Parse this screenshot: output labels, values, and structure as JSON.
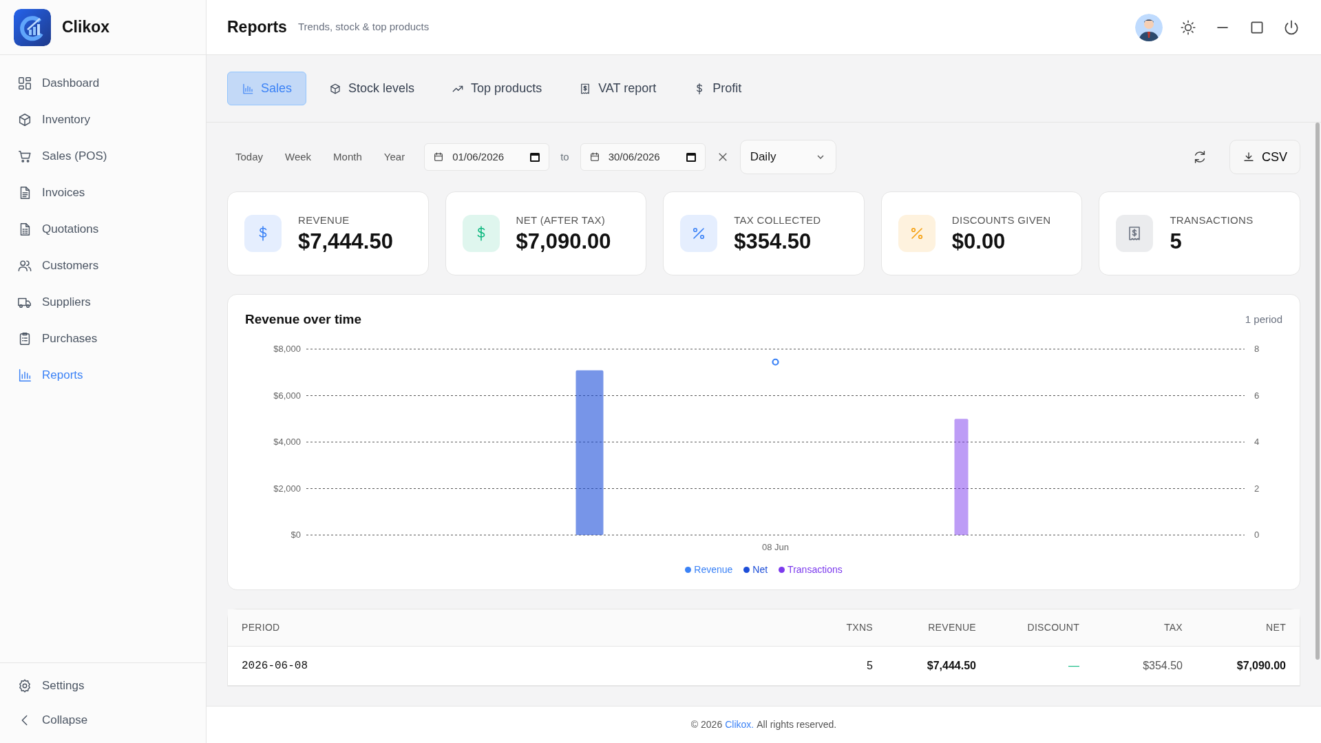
{
  "app": {
    "name": "Clikox"
  },
  "sidebar": {
    "items": [
      {
        "label": "Dashboard",
        "selected": false
      },
      {
        "label": "Inventory",
        "selected": false
      },
      {
        "label": "Sales (POS)",
        "selected": false
      },
      {
        "label": "Invoices",
        "selected": false
      },
      {
        "label": "Quotations",
        "selected": false
      },
      {
        "label": "Customers",
        "selected": false
      },
      {
        "label": "Suppliers",
        "selected": false
      },
      {
        "label": "Purchases",
        "selected": false
      },
      {
        "label": "Reports",
        "selected": true
      }
    ],
    "bottom": [
      {
        "label": "Settings"
      },
      {
        "label": "Collapse"
      }
    ]
  },
  "header": {
    "title": "Reports",
    "subtitle": "Trends, stock & top products"
  },
  "tabs": [
    {
      "label": "Sales",
      "selected": true
    },
    {
      "label": "Stock levels",
      "selected": false
    },
    {
      "label": "Top products",
      "selected": false
    },
    {
      "label": "VAT report",
      "selected": false
    },
    {
      "label": "Profit",
      "selected": false
    }
  ],
  "filters": {
    "presets": [
      {
        "label": "Today",
        "selected": false
      },
      {
        "label": "Week",
        "selected": false
      },
      {
        "label": "Month",
        "selected": false
      },
      {
        "label": "Year",
        "selected": false
      }
    ],
    "from": "01/06/2026",
    "to_label": "to",
    "to": "30/06/2026",
    "grouping": "Daily",
    "export": "CSV"
  },
  "stats": [
    {
      "label": "REVENUE",
      "value": "$7,444.50",
      "color": "#3b82f6"
    },
    {
      "label": "NET (AFTER TAX)",
      "value": "$7,090.00",
      "color": "#10b981"
    },
    {
      "label": "TAX COLLECTED",
      "value": "$354.50",
      "color": "#3b82f6"
    },
    {
      "label": "DISCOUNTS GIVEN",
      "value": "$0.00",
      "color": "#f59e0b"
    },
    {
      "label": "TRANSACTIONS",
      "value": "5",
      "color": "#6b7280"
    }
  ],
  "chart": {
    "title": "Revenue over time",
    "note": "1 period",
    "chart_data": {
      "type": "bar",
      "categories": [
        "08 Jun"
      ],
      "grid": true,
      "series": [
        {
          "name": "Revenue",
          "type": "scatter",
          "color": "#3b82f6",
          "values": [
            7444.5
          ]
        },
        {
          "name": "Net",
          "color": "#1d4ed8",
          "values": [
            7090
          ]
        }
      ],
      "ylim": [
        0,
        8000
      ],
      "yticks": [
        {
          "value": 0,
          "label": "$0"
        },
        {
          "value": 2000,
          "label": "$2,000"
        },
        {
          "value": 4000,
          "label": "$4,000"
        },
        {
          "value": 6000,
          "label": "$6,000"
        },
        {
          "value": 8000,
          "label": "$8,000"
        }
      ]
    },
    "secondary": {
      "chart_data": {
        "type": "bar",
        "categories": [
          null
        ],
        "grid": true,
        "series": [
          {
            "name": "Transactions",
            "color": "#7c3aed",
            "values": [
              5
            ]
          }
        ],
        "ylim": [
          0,
          8
        ],
        "yticks": [
          0,
          2,
          4,
          6,
          8
        ]
      }
    }
  },
  "table": {
    "columns": [
      "PERIOD",
      "TXNS",
      "REVENUE",
      "DISCOUNT",
      "TAX",
      "NET"
    ],
    "rows": [
      [
        "2026-06-08",
        "5",
        "$7,444.50",
        "—",
        "$354.50",
        "$7,090.00"
      ]
    ]
  },
  "footer": {
    "prefix": "© 2026",
    "link": "Clikox.",
    "suffix": "All rights reserved."
  }
}
